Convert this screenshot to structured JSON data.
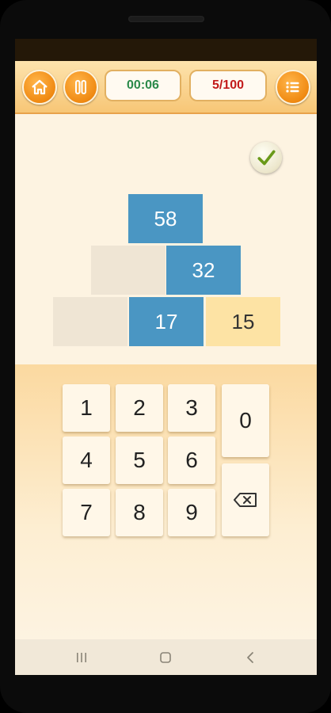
{
  "header": {
    "timer": "00:06",
    "progress": "5/100"
  },
  "icons": {
    "home": "home-icon",
    "pause": "pause-icon",
    "menu": "menu-icon",
    "check": "checkmark-icon",
    "backspace": "backspace-icon"
  },
  "pyramid": {
    "top": "58",
    "middle_right": "32",
    "bottom_middle": "17",
    "bottom_right": "15"
  },
  "keypad": {
    "k1": "1",
    "k2": "2",
    "k3": "3",
    "k0": "0",
    "k4": "4",
    "k5": "5",
    "k6": "6",
    "k7": "7",
    "k8": "8",
    "k9": "9"
  },
  "colors": {
    "header_orange": "#f7c676",
    "block_blue": "#4a96c3",
    "answer_yellow": "#fde3a4",
    "empty_cell": "#efe5d4",
    "timer_green": "#2a8a4a",
    "counter_red": "#c21a1a"
  }
}
